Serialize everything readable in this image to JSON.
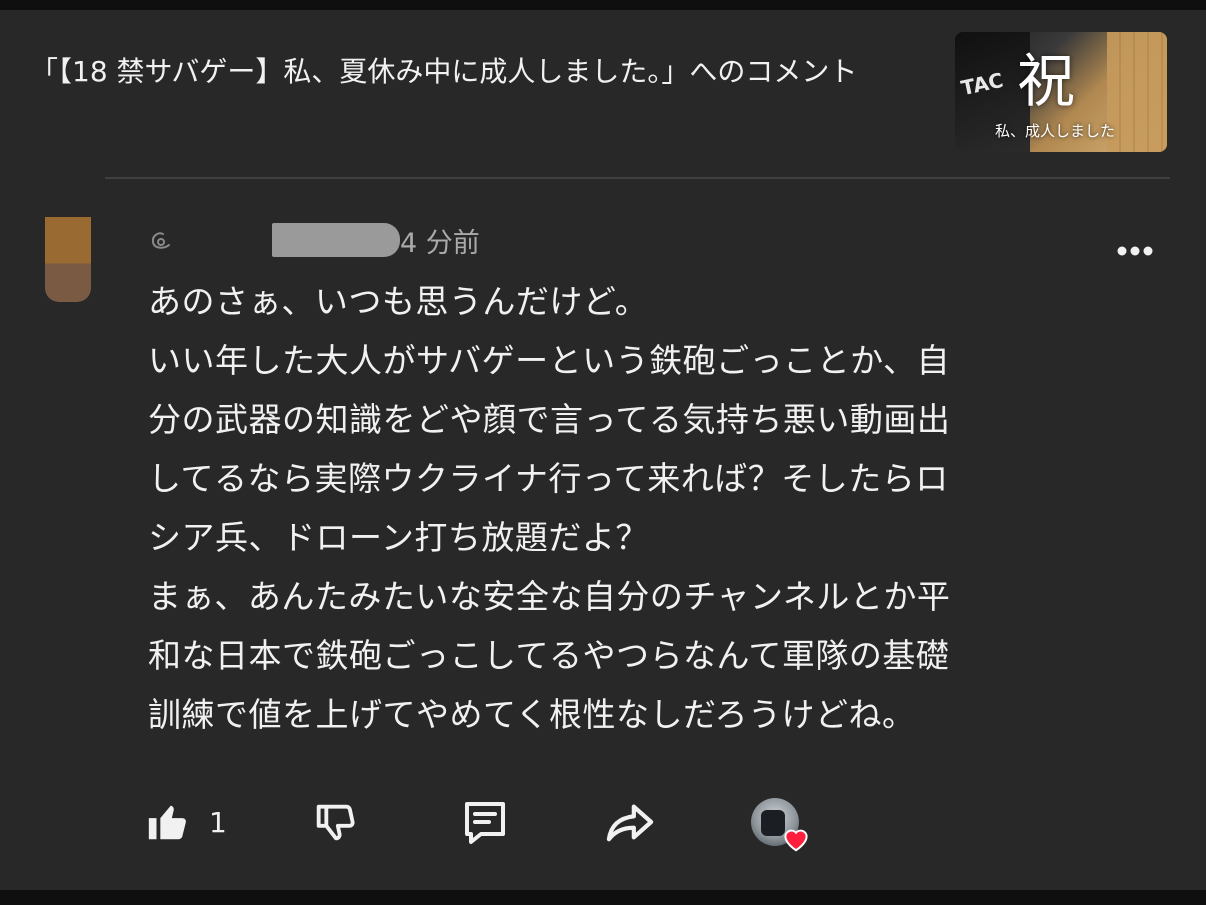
{
  "header": {
    "title": "「【18 禁サバゲー】私、夏休み中に成人しました。」へのコメント",
    "thumbnail": {
      "tac_text": "TAC",
      "kanji": "祝",
      "subtitle": "私、成人しました"
    }
  },
  "comment": {
    "timestamp": "4 分前",
    "lines": [
      "あのさぁ、いつも思うんだけど。",
      "いい年した大人がサバゲーという鉄砲ごっことか、自",
      "分の武器の知識をどや顔で言ってる気持ち悪い動画出",
      "してるなら実際ウクライナ行って来れば？そしたらロ",
      "シア兵、ドローン打ち放題だよ？",
      "まぁ、あんたみたいな安全な自分のチャンネルとか平",
      "和な日本で鉄砲ごっこしてるやつらなんて軍隊の基礎",
      "訓練で値を上げてやめてく根性なしだろうけどね。"
    ],
    "like_count": "1"
  },
  "icons": {
    "handle": "at-handle-icon",
    "more": "more-vertical-dots-icon",
    "like": "thumbs-up-filled-icon",
    "dislike": "thumbs-down-icon",
    "reply": "comment-reply-icon",
    "share": "share-arrow-icon",
    "heart": "creator-heart-icon"
  },
  "colors": {
    "background": "#282828",
    "outer": "#0f0f0f",
    "text": "#f1f1f1",
    "secondary_text": "#aaaaaa",
    "heart": "#ff1f3d"
  }
}
